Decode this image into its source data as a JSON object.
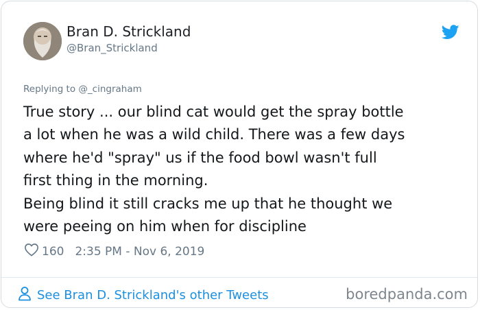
{
  "author": {
    "name": "Bran D. Strickland",
    "handle": "@Bran_Strickland"
  },
  "reply_to": "Replying to @_cingraham",
  "tweet": {
    "lines": [
      "True story ... our blind cat would get the spray bottle",
      "a lot when he was a wild child. There was a few days",
      "where he'd \"spray\" us if the food bowl wasn't full",
      "first thing in the morning.",
      "Being blind it still cracks me up that he thought we",
      "were peeing on him when for discipline"
    ]
  },
  "meta": {
    "likes": "160",
    "timestamp": "2:35 PM - Nov 6, 2019"
  },
  "footer": {
    "see_more": "See Bran D. Strickland's other Tweets",
    "watermark": "boredpanda.com"
  },
  "colors": {
    "link": "#1b8fe0",
    "twitter_blue": "#1da1f2",
    "muted": "#657786"
  },
  "icons": {
    "brand": "twitter-bird-icon",
    "like": "heart-icon",
    "profile": "person-icon"
  }
}
